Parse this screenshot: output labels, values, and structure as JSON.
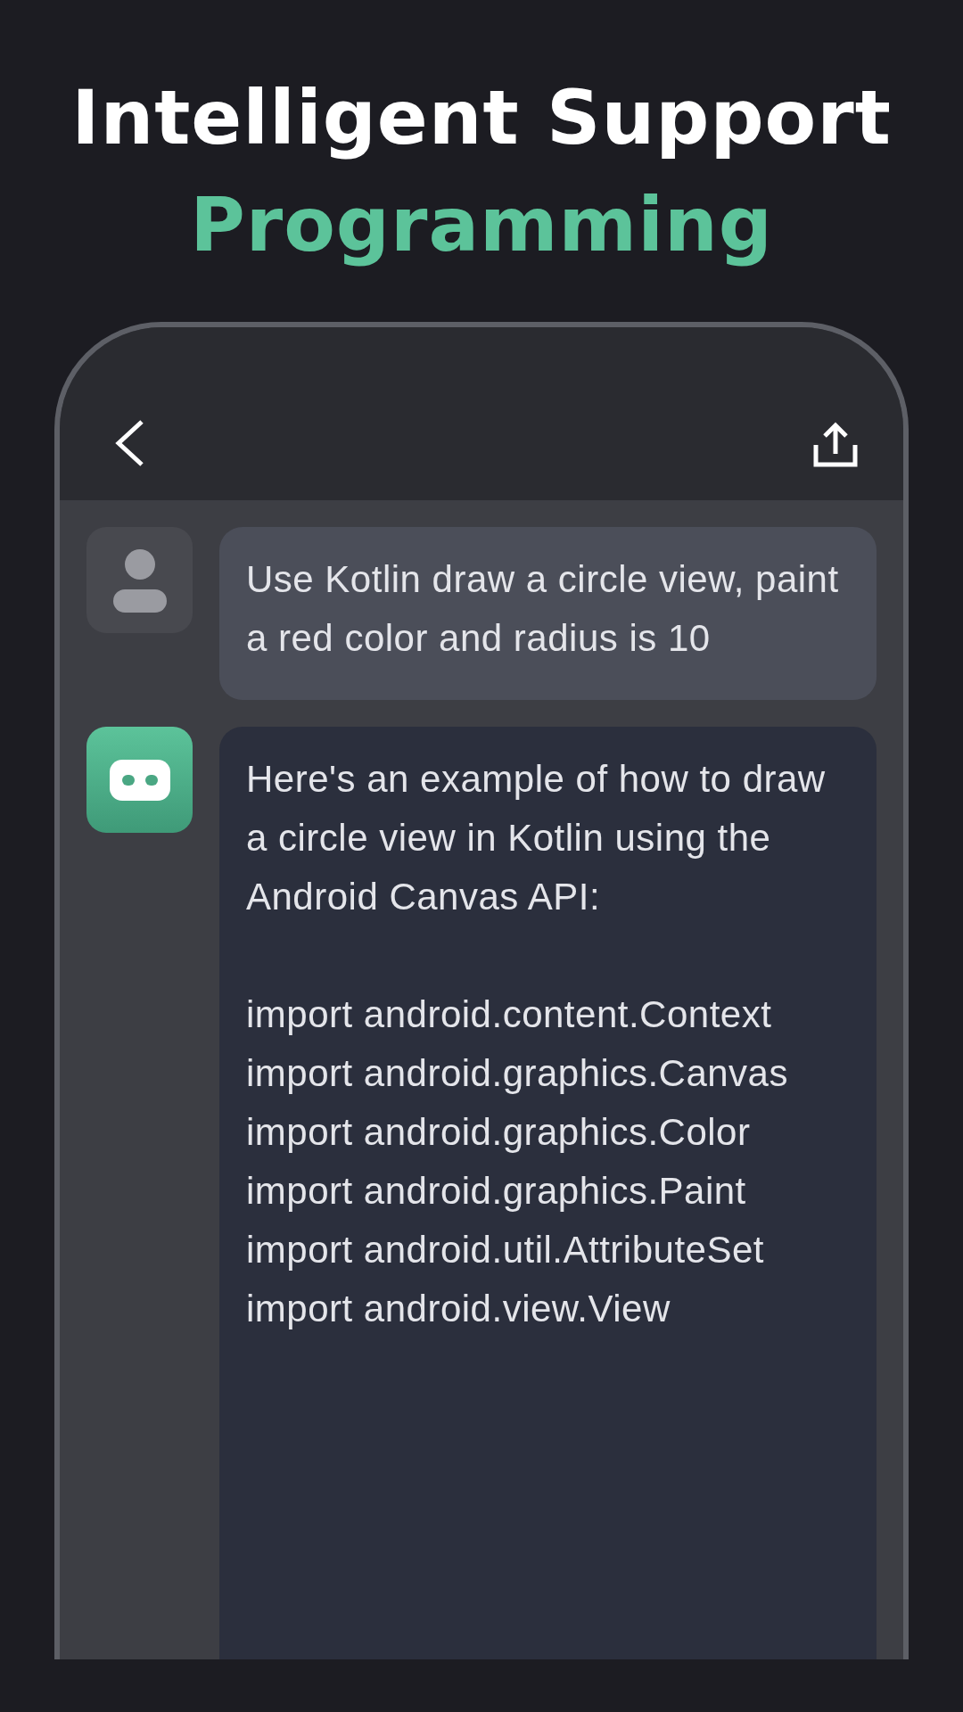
{
  "headline": {
    "title": "Intelligent Support",
    "subtitle": "Programming"
  },
  "chat": {
    "messages": [
      {
        "kind": "user",
        "text": "Use Kotlin draw a circle view, paint a red color and radius is 10"
      },
      {
        "kind": "bot",
        "paragraphs": [
          "Here's an example of how to draw a circle view in Kotlin using the Android Canvas API:",
          "import android.content.Context\nimport android.graphics.Canvas\nimport android.graphics.Color\nimport android.graphics.Paint\nimport android.util.AttributeSet\nimport android.view.View"
        ]
      }
    ]
  }
}
